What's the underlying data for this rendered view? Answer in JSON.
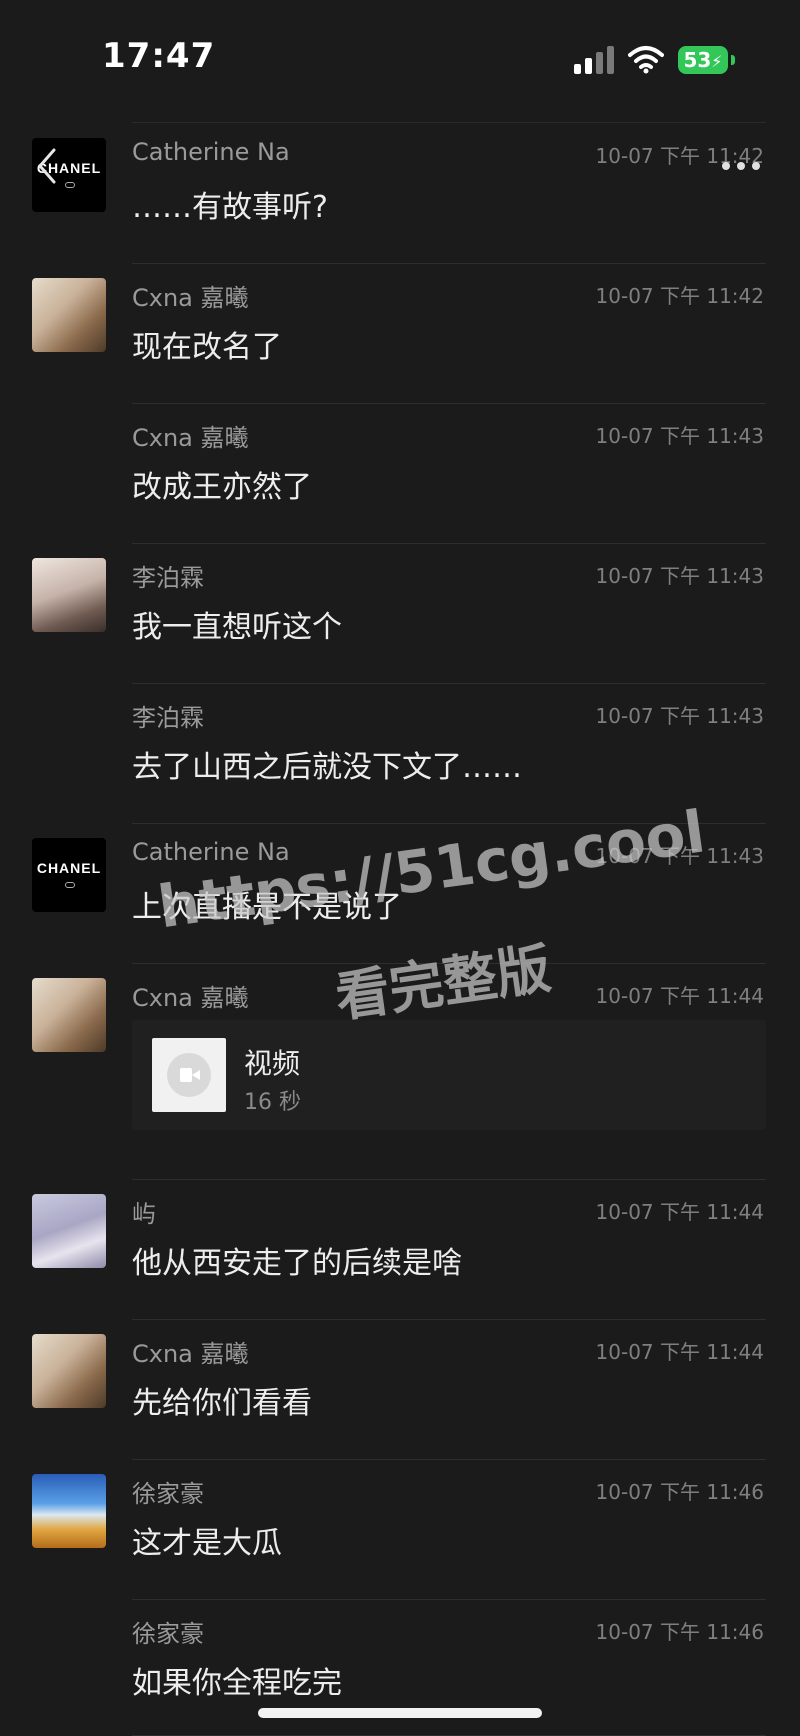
{
  "status_bar": {
    "time": "17:47",
    "battery": "53"
  },
  "messages": [
    {
      "avatar": "chanel",
      "avatar_text": "CHANEL",
      "name": "Catherine Na",
      "time": "10-07 下午 11:42",
      "text": "……有故事听?"
    },
    {
      "avatar": "girl",
      "name": "Cxna 嘉曦",
      "time": "10-07 下午 11:42",
      "text": "现在改名了"
    },
    {
      "avatar": "none",
      "name": "Cxna 嘉曦",
      "time": "10-07 下午 11:43",
      "text": "改成王亦然了"
    },
    {
      "avatar": "girl2",
      "name": "李泊霖",
      "time": "10-07 下午 11:43",
      "text": "我一直想听这个"
    },
    {
      "avatar": "none",
      "name": "李泊霖",
      "time": "10-07 下午 11:43",
      "text": "去了山西之后就没下文了……"
    },
    {
      "avatar": "chanel",
      "avatar_text": "CHANEL",
      "name": "Catherine Na",
      "time": "10-07 下午 11:43",
      "text": "上次直播是不是说了"
    },
    {
      "avatar": "girl",
      "name": "Cxna 嘉曦",
      "time": "10-07 下午 11:44",
      "type": "video",
      "video_label": "视频",
      "video_duration": "16 秒"
    },
    {
      "avatar": "girl3",
      "name": "屿",
      "time": "10-07 下午 11:44",
      "text": "他从西安走了的后续是啥"
    },
    {
      "avatar": "girl",
      "name": "Cxna 嘉曦",
      "time": "10-07 下午 11:44",
      "text": "先给你们看看"
    },
    {
      "avatar": "sky",
      "name": "徐家豪",
      "time": "10-07 下午 11:46",
      "text": "这才是大瓜"
    },
    {
      "avatar": "none",
      "name": "徐家豪",
      "time": "10-07 下午 11:46",
      "text": "如果你全程吃完"
    }
  ],
  "watermark": {
    "url": "https://51cg.cool",
    "subtitle": "看完整版"
  }
}
